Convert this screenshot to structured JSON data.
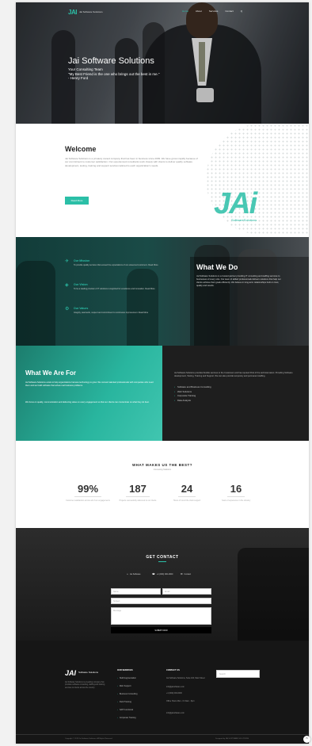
{
  "header": {
    "logo_mark": "JAI",
    "logo_text": "Jai Software Solutions",
    "nav": [
      "Home",
      "About",
      "Services",
      "Contact",
      "Q"
    ]
  },
  "hero": {
    "title": "Jai Software Solutions",
    "line1": "Your Consulting Team",
    "quote": "\"My Best Friend is the one who brings out the best in me.\"",
    "author": "- Henry Ford"
  },
  "welcome": {
    "title": "Welcome",
    "body": "Jai Software Solutions is a privately owned company that has been in business since 2009. We have grown rapidly because of our commitment to customer satisfaction. Our experienced consultants work closely with clients to deliver quality software development, testing, training and support services tailored to each organization's needs.",
    "button": "Read More",
    "logo_big": "JAi",
    "logo_small": "SoftwareSolutions"
  },
  "what_we_do": {
    "title": "What We Do",
    "body": "Jai Software Solutions is a trusted partner providing IT consulting and staffing services to businesses of every size. Our team of skilled professionals delivers solutions that help our clients achieve their goals efficiently. We believe in long-term relationships built on trust, quality and results.",
    "services": [
      {
        "icon": "✈",
        "title": "Our Mission",
        "desc": "To provide quality services that exceed the expectations of our esteemed customers. Read More"
      },
      {
        "icon": "◈",
        "title": "Our Vision",
        "desc": "To be a leading provider of IT solutions recognized for excellence and innovation. Read More"
      },
      {
        "icon": "⚙",
        "title": "Our Values",
        "desc": "Integrity, teamwork, respect and commitment to continuous improvement. Read More"
      }
    ]
  },
  "what_we_are_for": {
    "title": "What We Are For",
    "left_p1": "Jai Software Solutions exists to help organizations harness technology to grow. We connect talented professionals with companies who need them and we build software that solves real business problems.",
    "left_p2": "We focus on quality, communication and delivering value on every engagement so that our clients can concentrate on what they do best.",
    "right_p": "Jai Software Solutions provides flexible services to the Customers and has reputed Pool of the technical talent. Providing Software development, Testing, Training and Support, We can also provide temporary and permanent staffing.",
    "items": [
      "Software and Business Consulting",
      "Web Solutions",
      "Corporate Training",
      "Data Analysis"
    ]
  },
  "stats": {
    "title": "WHAT MAKES US THE BEST?",
    "subtitle": "Interesting Statistics",
    "items": [
      {
        "num": "99%",
        "label": "Customer satisfaction across all of our engagements"
      },
      {
        "num": "187",
        "label": "Projects successfully delivered to our clients"
      },
      {
        "num": "24",
        "label": "Hours of round the clock support"
      },
      {
        "num": "16",
        "label": "Years of experience in the industry"
      }
    ]
  },
  "contact": {
    "title": "GET CONTACT",
    "info": [
      "Jai Software",
      "+1 (000) 000-0000",
      "Contact"
    ],
    "name_placeholder": "Name",
    "email_placeholder": "Email",
    "subject_placeholder": "Subject",
    "message_placeholder": "Message",
    "submit": "SUBMIT NOW"
  },
  "footer": {
    "logo_mark": "JAI",
    "logo_text": "Software Solutions",
    "desc": "Jai Software Solutions is a leading company that provides software consulting, staffing and training services to clients across the country.",
    "services_heading": "OUR SERVICES",
    "services": [
      "Staff Augmentation",
      "Web Support",
      "Business Consulting",
      "Field Training",
      "SAP Functional",
      "Corporate Training"
    ],
    "contact_heading": "CONTACT US",
    "contact": [
      "Jai Software Solutions, Suite 100, Main Street",
      "info@jaisoftware.com",
      "+1 (000) 000-0000",
      "Office Hours Mon - Fri 9am - 6pm",
      "info@jaisoftware.com"
    ],
    "search_placeholder": "Search",
    "copyright": "Copyright © 2019 Jai Software Solutions. All Rights Reserved.",
    "credit": "Designed by JAI SOFTWARE SOLUTIONS"
  },
  "to_top": "^"
}
